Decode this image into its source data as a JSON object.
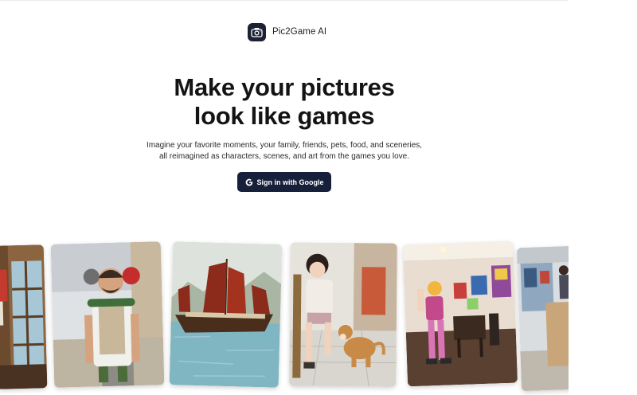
{
  "brand": {
    "name": "Pic2Game AI",
    "logo_icon": "camera-icon"
  },
  "hero": {
    "title_line1": "Make your pictures",
    "title_line2": "look like games",
    "subtitle_line1": "Imagine your favorite moments, your family, friends, pets, food, and sceneries,",
    "subtitle_line2": "all reimagined as characters, scenes, and art from the games you love."
  },
  "cta": {
    "label": "Sign in with Google",
    "icon": "google-icon"
  },
  "gallery": {
    "cards": [
      {
        "name": "gallery-card-window-room"
      },
      {
        "name": "gallery-card-toy-figure"
      },
      {
        "name": "gallery-card-junk-ship"
      },
      {
        "name": "gallery-card-girl-with-dog"
      },
      {
        "name": "gallery-card-dancer-room"
      },
      {
        "name": "gallery-card-street-shop"
      }
    ]
  },
  "colors": {
    "button_bg": "#16203a",
    "logo_bg": "#1c2233",
    "text_dark": "#141414"
  }
}
